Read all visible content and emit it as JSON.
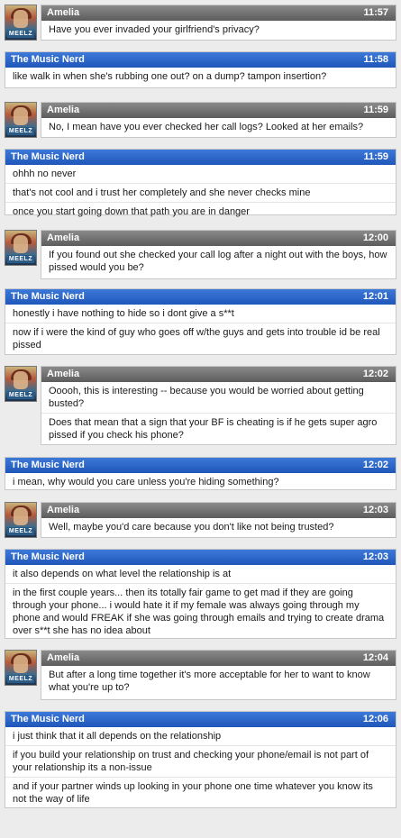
{
  "messages": [
    {
      "sender": "Amelia",
      "time": "11:57",
      "lines": [
        "Have you ever invaded your girlfriend's privacy?"
      ]
    },
    {
      "sender": "The Music Nerd",
      "time": "11:58",
      "lines": [
        "like walk in when she's rubbing one out? on a dump? tampon insertion?"
      ]
    },
    {
      "sender": "Amelia",
      "time": "11:59",
      "lines": [
        "No, I mean have you ever checked her call logs? Looked at her emails?"
      ]
    },
    {
      "sender": "The Music Nerd",
      "time": "11:59",
      "lines": [
        "ohhh no never",
        "that's not cool and i trust her completely and she never checks mine",
        "once you start going down that path you are in danger"
      ]
    },
    {
      "sender": "Amelia",
      "time": "12:00",
      "lines": [
        "If you found out she checked your call log after a night out with the boys, how pissed would you be?"
      ]
    },
    {
      "sender": "The Music Nerd",
      "time": "12:01",
      "lines": [
        "honestly i have nothing to hide so i dont give a s**t",
        "now  if i were the kind of guy who goes off w/the guys and gets into trouble id be real pissed"
      ]
    },
    {
      "sender": "Amelia",
      "time": "12:02",
      "lines": [
        "Ooooh, this is interesting -- because you would be worried about getting busted?",
        "Does that mean that a sign that your BF is cheating is if he gets super agro pissed if you check his phone?"
      ]
    },
    {
      "sender": "The Music Nerd",
      "time": "12:02",
      "lines": [
        "i mean, why would you care unless you're hiding something?"
      ]
    },
    {
      "sender": "Amelia",
      "time": "12:03",
      "lines": [
        "Well, maybe you'd care because you don't like not being trusted?"
      ]
    },
    {
      "sender": "The Music Nerd",
      "time": "12:03",
      "lines": [
        "it also depends on what level the relationship is at",
        "in the first couple years... then its totally fair game to get mad if they are going through your phone... i would hate it if my female was always going through my phone  and would FREAK if she was going through emails and trying to create drama over s**t  she has no idea about"
      ]
    },
    {
      "sender": "Amelia",
      "time": "12:04",
      "lines": [
        "But after a long time together it's more acceptable for her to want to know what you're up to?"
      ]
    },
    {
      "sender": "The Music Nerd",
      "time": "12:06",
      "lines": [
        "i just think that it all depends on the relationship",
        "if you build your relationship on trust  and checking your phone/email is not part of your relationship its a non-issue",
        "and if your partner winds up looking in your phone one time whatever you know its not the way of life"
      ]
    }
  ],
  "avatar": {
    "label": "MEELZ"
  },
  "colors": {
    "amelia_header": "#6e6e6e",
    "nerd_header": "#2a63c8",
    "background": "#ececec"
  }
}
